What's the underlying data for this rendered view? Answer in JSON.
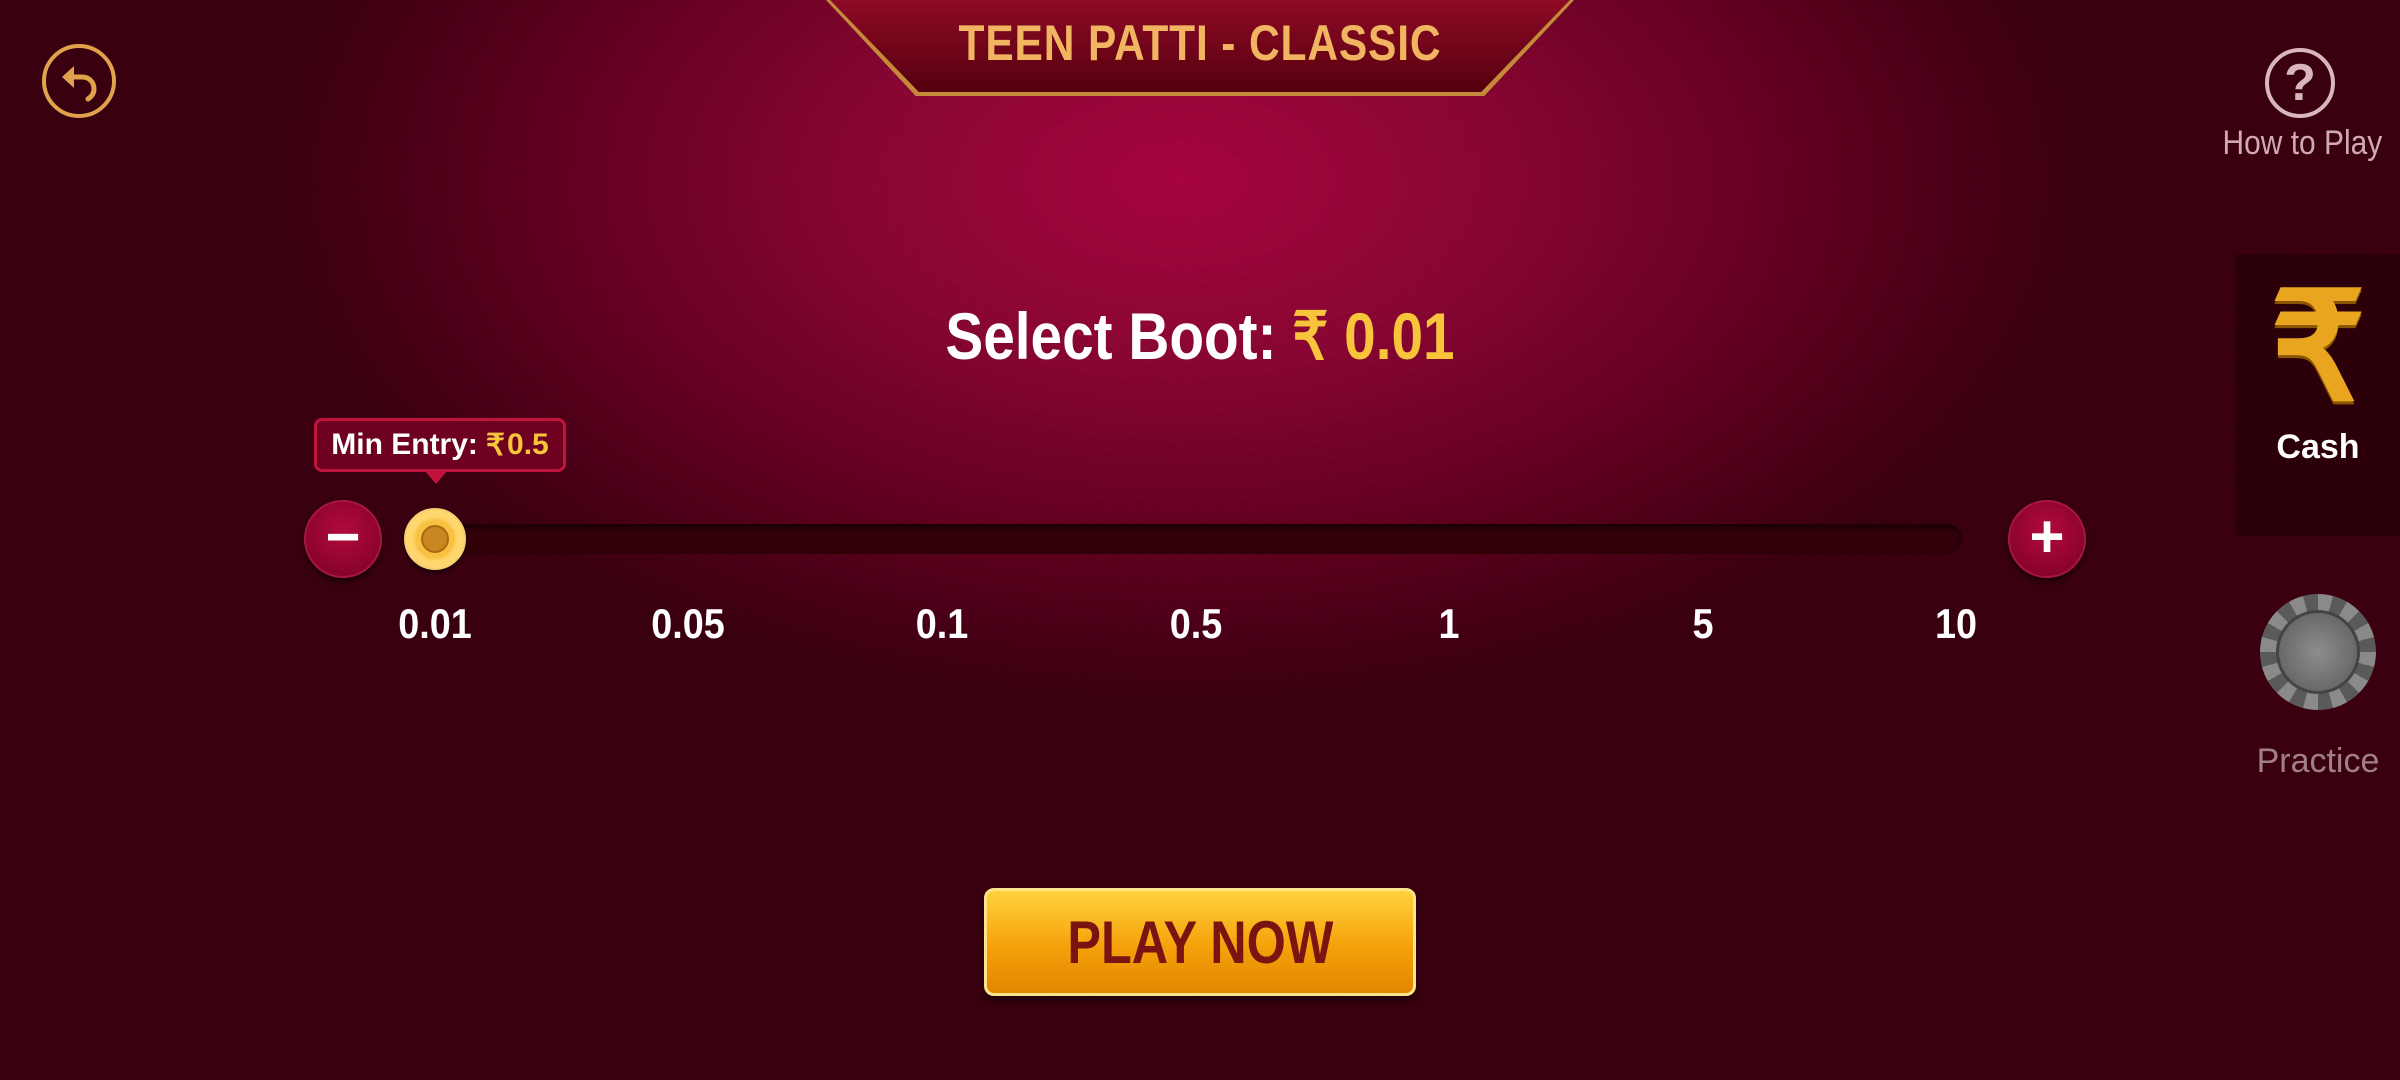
{
  "header": {
    "title": "TEEN PATTI - CLASSIC"
  },
  "help": {
    "label": "How to Play",
    "glyph": "?"
  },
  "boot": {
    "label": "Select Boot:",
    "currency": "₹",
    "value": "0.01"
  },
  "min_entry": {
    "label": "Min Entry:",
    "currency": "₹",
    "value": "0.5"
  },
  "slider": {
    "ticks": [
      "0.01",
      "0.05",
      "0.1",
      "0.5",
      "1",
      "5",
      "10"
    ],
    "selected_index": 0,
    "minus_glyph": "−",
    "plus_glyph": "+"
  },
  "side_panel": {
    "cash_label": "Cash",
    "cash_glyph": "₹",
    "practice_label": "Practice"
  },
  "play_button": {
    "label": "PLAY NOW"
  },
  "colors": {
    "accent_gold": "#f7c43c",
    "background": "#8a0634",
    "button_text": "#7a1412"
  },
  "icons": {
    "back": "back-arrow-icon",
    "help": "question-circle-icon",
    "cash": "rupee-icon",
    "practice": "chip-icon"
  }
}
